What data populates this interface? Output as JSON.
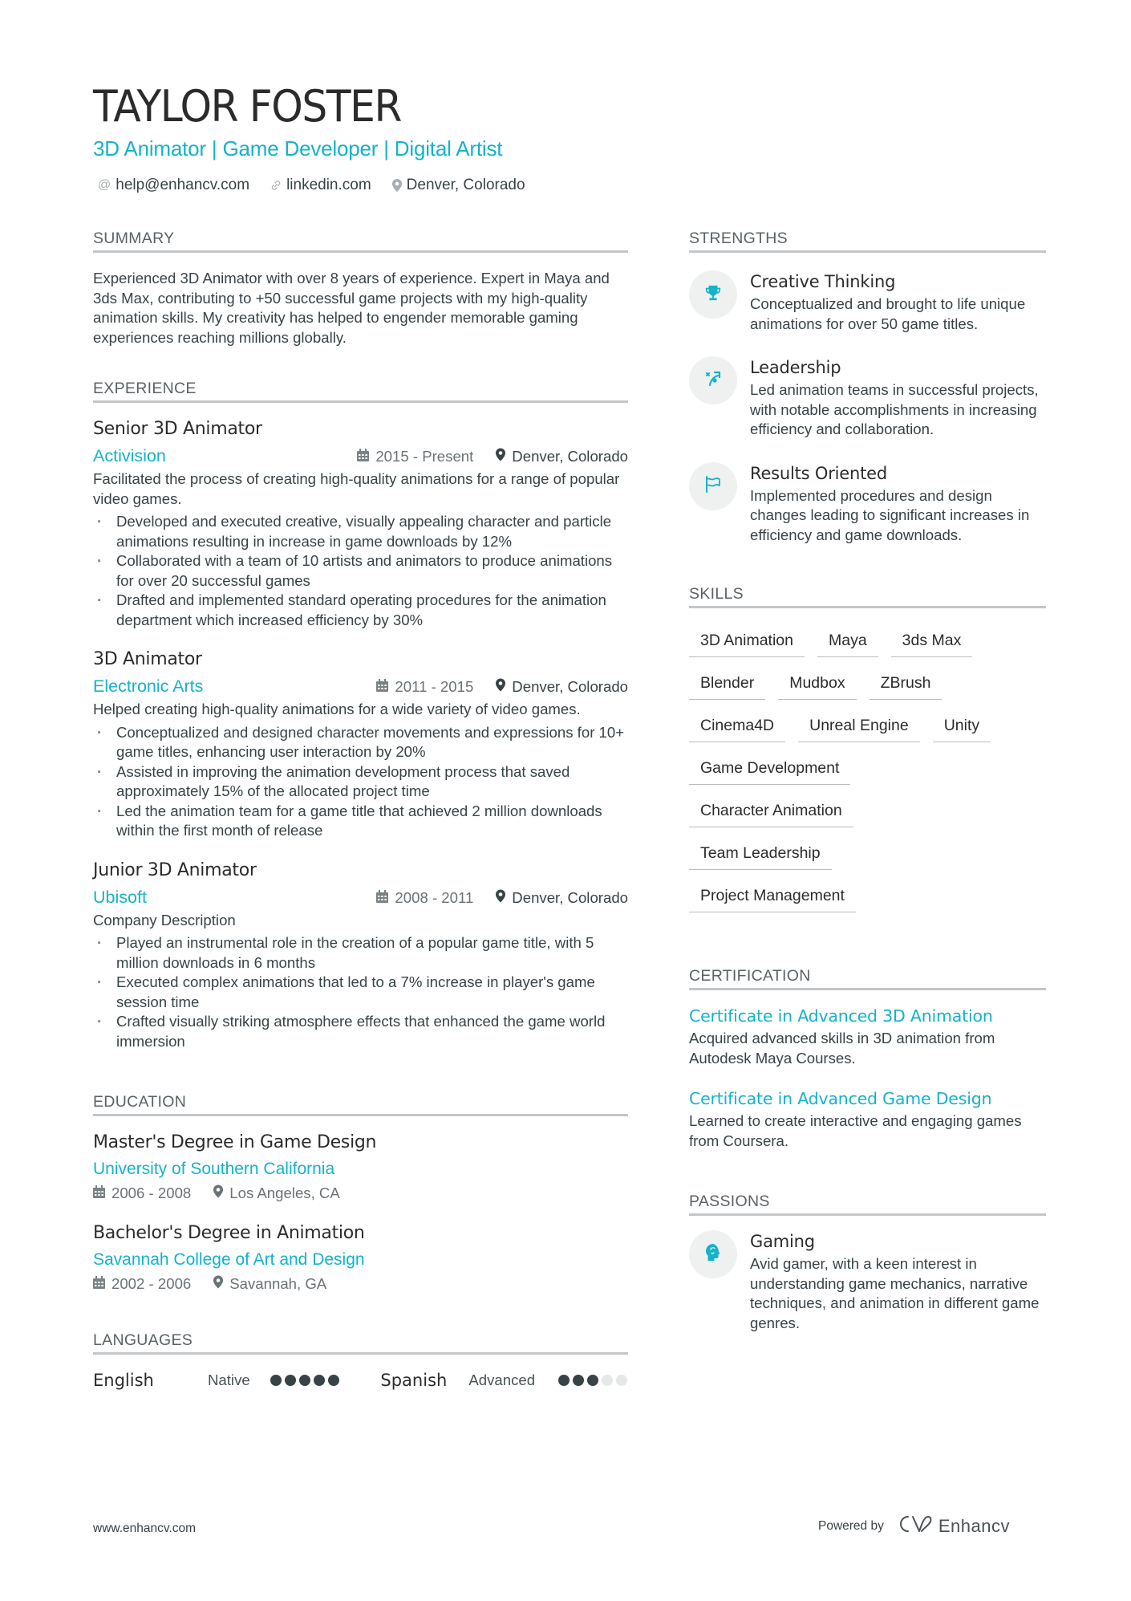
{
  "header": {
    "name": "TAYLOR FOSTER",
    "title": "3D Animator | Game Developer | Digital Artist",
    "contacts": [
      {
        "icon": "at-icon",
        "text": "help@enhancv.com"
      },
      {
        "icon": "link-icon",
        "text": "linkedin.com"
      },
      {
        "icon": "location-pin-icon",
        "text": "Denver, Colorado"
      }
    ]
  },
  "colors": {
    "accent": "#14b3c8",
    "text": "#384347",
    "heading": "#2b2b2b",
    "rule": "#c3c6c8",
    "icon_bg": "#eff1f1"
  },
  "summary": {
    "heading": "SUMMARY",
    "text": "Experienced 3D Animator with over 8 years of experience. Expert in Maya and 3ds Max, contributing to +50 successful game projects with my high-quality animation skills. My creativity has helped to engender memorable gaming experiences reaching millions globally."
  },
  "experience": {
    "heading": "EXPERIENCE",
    "jobs": [
      {
        "title": "Senior 3D Animator",
        "company": "Activision",
        "dates": "2015 - Present",
        "location": "Denver, Colorado",
        "description": "Facilitated the process of creating high-quality animations for a range of popular video games.",
        "bullets": [
          "Developed and executed creative, visually appealing character and particle animations resulting in increase in game downloads by 12%",
          "Collaborated with a team of 10 artists and animators to produce animations for over 20 successful games",
          "Drafted and implemented standard operating procedures for the animation department which increased efficiency by 30%"
        ]
      },
      {
        "title": "3D Animator",
        "company": "Electronic Arts",
        "dates": "2011 - 2015",
        "location": "Denver, Colorado",
        "description": "Helped creating high-quality animations for a wide variety of video games.",
        "bullets": [
          "Conceptualized and designed character movements and expressions for 10+ game titles, enhancing user interaction by 20%",
          "Assisted in improving the animation development process that saved approximately 15% of the allocated project time",
          "Led the animation team for a game title that achieved 2 million downloads within the first month of release"
        ]
      },
      {
        "title": "Junior 3D Animator",
        "company": "Ubisoft",
        "dates": "2008 - 2011",
        "location": "Denver, Colorado",
        "description": "Company Description",
        "bullets": [
          "Played an instrumental role in the creation of a popular game title, with 5 million downloads in 6 months",
          "Executed complex animations that led to a 7% increase in player's game session time",
          "Crafted visually striking atmosphere effects that enhanced the game world immersion"
        ]
      }
    ]
  },
  "education": {
    "heading": "EDUCATION",
    "items": [
      {
        "degree": "Master's Degree in Game Design",
        "school": "University of Southern California",
        "dates": "2006 - 2008",
        "location": "Los Angeles, CA"
      },
      {
        "degree": "Bachelor's Degree in Animation",
        "school": "Savannah College of Art and Design",
        "dates": "2002 - 2006",
        "location": "Savannah, GA"
      }
    ]
  },
  "languages": {
    "heading": "LANGUAGES",
    "items": [
      {
        "name": "English",
        "level": "Native",
        "rating": 5,
        "max": 5
      },
      {
        "name": "Spanish",
        "level": "Advanced",
        "rating": 3,
        "max": 5
      }
    ]
  },
  "strengths": {
    "heading": "STRENGTHS",
    "items": [
      {
        "icon": "trophy-icon",
        "title": "Creative Thinking",
        "description": "Conceptualized and brought to life unique animations for over 50 game titles."
      },
      {
        "icon": "strategy-icon",
        "title": "Leadership",
        "description": "Led animation teams in successful projects, with notable accomplishments in increasing efficiency and collaboration."
      },
      {
        "icon": "flag-icon",
        "title": "Results Oriented",
        "description": "Implemented procedures and design changes leading to significant increases in efficiency and game downloads."
      }
    ]
  },
  "skills": {
    "heading": "SKILLS",
    "items": [
      "3D Animation",
      "Maya",
      "3ds Max",
      "Blender",
      "Mudbox",
      "ZBrush",
      "Cinema4D",
      "Unreal Engine",
      "Unity",
      "Game Development",
      "Character Animation",
      "Team Leadership",
      "Project Management"
    ]
  },
  "certification": {
    "heading": "CERTIFICATION",
    "items": [
      {
        "title": "Certificate in Advanced 3D Animation",
        "description": "Acquired advanced skills in 3D animation from Autodesk Maya Courses."
      },
      {
        "title": "Certificate in Advanced Game Design",
        "description": "Learned to create interactive and engaging games from Coursera."
      }
    ]
  },
  "passions": {
    "heading": "PASSIONS",
    "items": [
      {
        "icon": "brain-head-icon",
        "title": "Gaming",
        "description": "Avid gamer, with a keen interest in understanding game mechanics, narrative techniques, and animation in different game genres."
      }
    ]
  },
  "footer": {
    "website": "www.enhancv.com",
    "powered_by": "Powered by",
    "brand": "Enhancv"
  }
}
